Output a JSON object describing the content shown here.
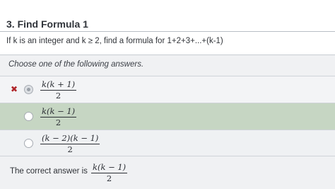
{
  "question": {
    "title": "3. Find Formula 1",
    "text": "If k is an integer and k ≥ 2, find a formula for 1+2+3+...+(k-1)"
  },
  "prompt": "Choose one of the following answers.",
  "answers": [
    {
      "numerator": "k(k + 1)",
      "denominator": "2",
      "selected": true,
      "marked_incorrect": true,
      "mark": "✖"
    },
    {
      "numerator": "k(k − 1)",
      "denominator": "2",
      "selected": false,
      "highlighted_correct": true
    },
    {
      "numerator": "(k − 2)(k − 1)",
      "denominator": "2",
      "selected": false
    }
  ],
  "feedback": {
    "label": "The correct answer is",
    "numerator": "k(k − 1)",
    "denominator": "2"
  },
  "colors": {
    "correct_highlight": "#c6d6c3",
    "incorrect_mark": "#b0262a"
  }
}
